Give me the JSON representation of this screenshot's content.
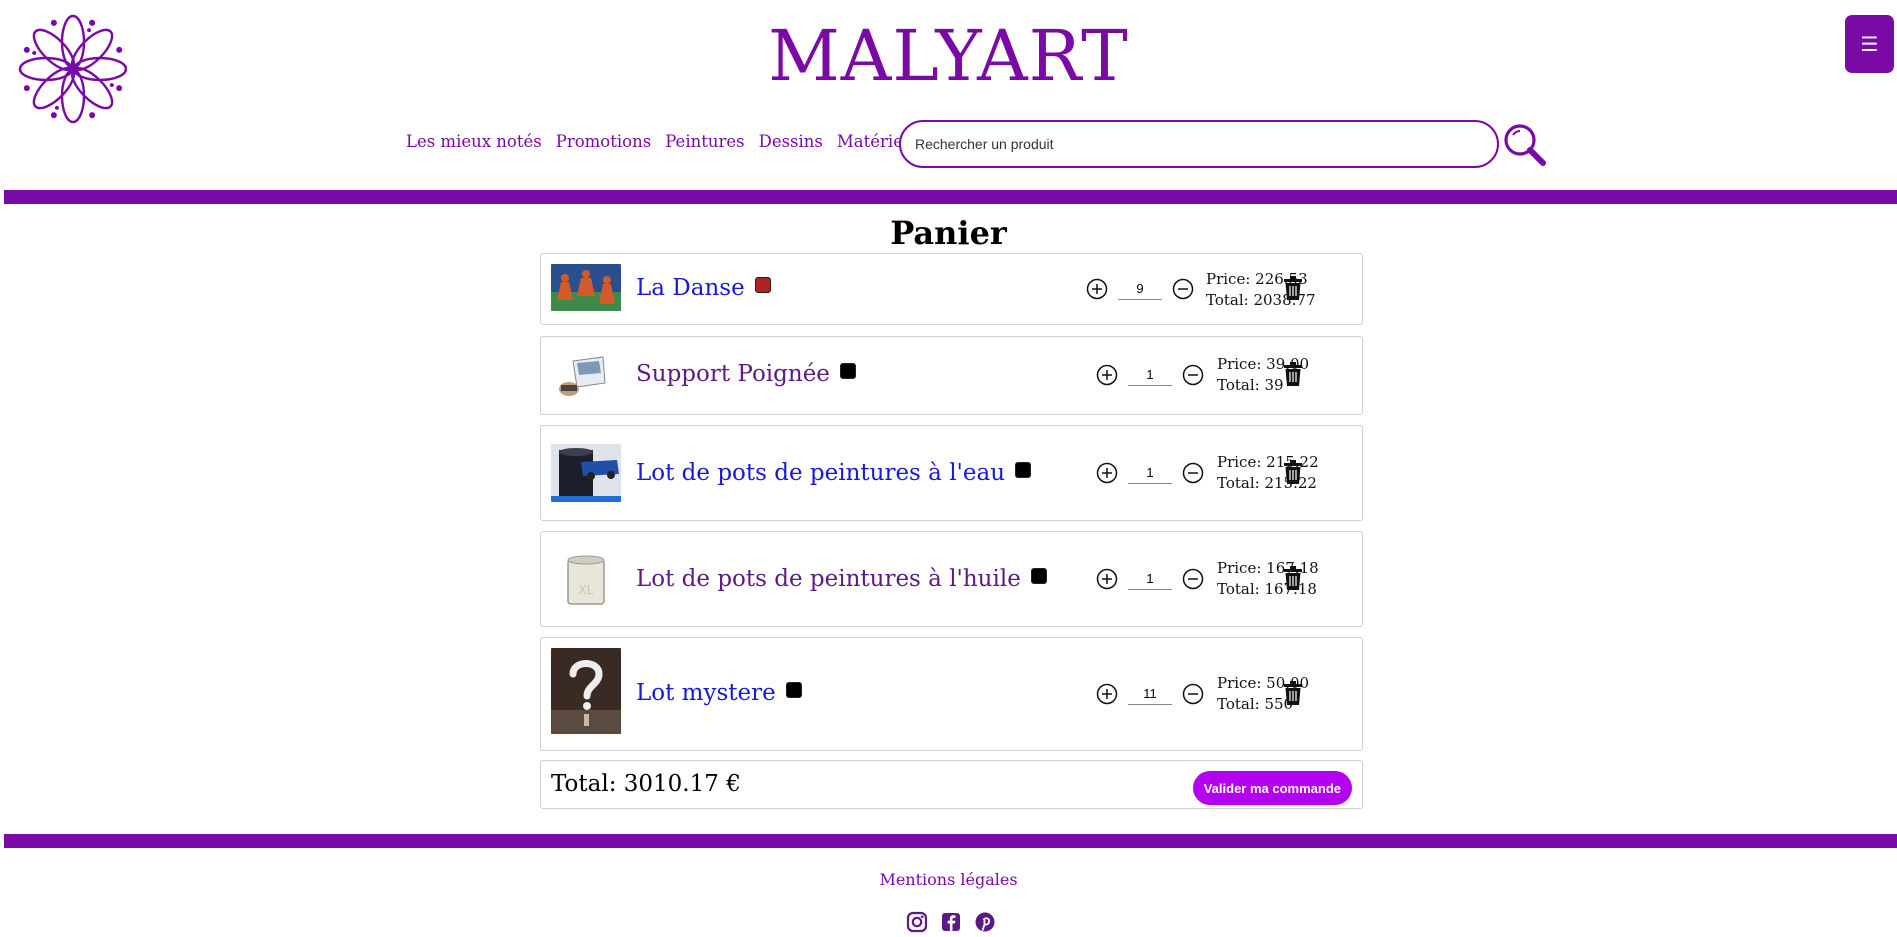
{
  "brand": {
    "name": "MALYART"
  },
  "menu": {
    "icon": "hamburger-icon",
    "label": "☰"
  },
  "nav": [
    {
      "label": "Les mieux notés"
    },
    {
      "label": "Promotions"
    },
    {
      "label": "Peintures"
    },
    {
      "label": "Dessins"
    },
    {
      "label": "Matériels d'art"
    }
  ],
  "search": {
    "placeholder": "Rechercher un produit",
    "value": "",
    "icon": "search-icon"
  },
  "cart": {
    "title": "Panier",
    "items": [
      {
        "name": "La Danse",
        "name_color": "blue",
        "swatch": "#b22222",
        "quantity": "9",
        "price": "Price: 226.53",
        "total": "Total: 2038.77"
      },
      {
        "name": "Support Poignée",
        "name_color": "purple",
        "swatch": "#000000",
        "quantity": "1",
        "price": "Price: 39.00",
        "total": "Total: 39"
      },
      {
        "name": "Lot de pots de peintures à l'eau",
        "name_color": "blue",
        "swatch": "#000000",
        "quantity": "1",
        "price": "Price: 215.22",
        "total": "Total: 215.22"
      },
      {
        "name": "Lot de pots de peintures à l'huile",
        "name_color": "purple",
        "swatch": "#000000",
        "quantity": "1",
        "price": "Price: 167.18",
        "total": "Total: 167.18"
      },
      {
        "name": "Lot mystere",
        "name_color": "blue",
        "swatch": "#000000",
        "quantity": "11",
        "price": "Price: 50.00",
        "total": "Total: 550"
      }
    ],
    "grand_total": "Total: 3010.17 €",
    "validate_label": "Valider ma commande"
  },
  "footer": {
    "legal_label": "Mentions légales",
    "socials": [
      "instagram-icon",
      "facebook-icon",
      "pinterest-icon"
    ]
  },
  "colors": {
    "accent": "#7a0aa6",
    "button": "#b400f0",
    "link_blue": "#1818d8",
    "link_purple": "#5b1a86"
  }
}
